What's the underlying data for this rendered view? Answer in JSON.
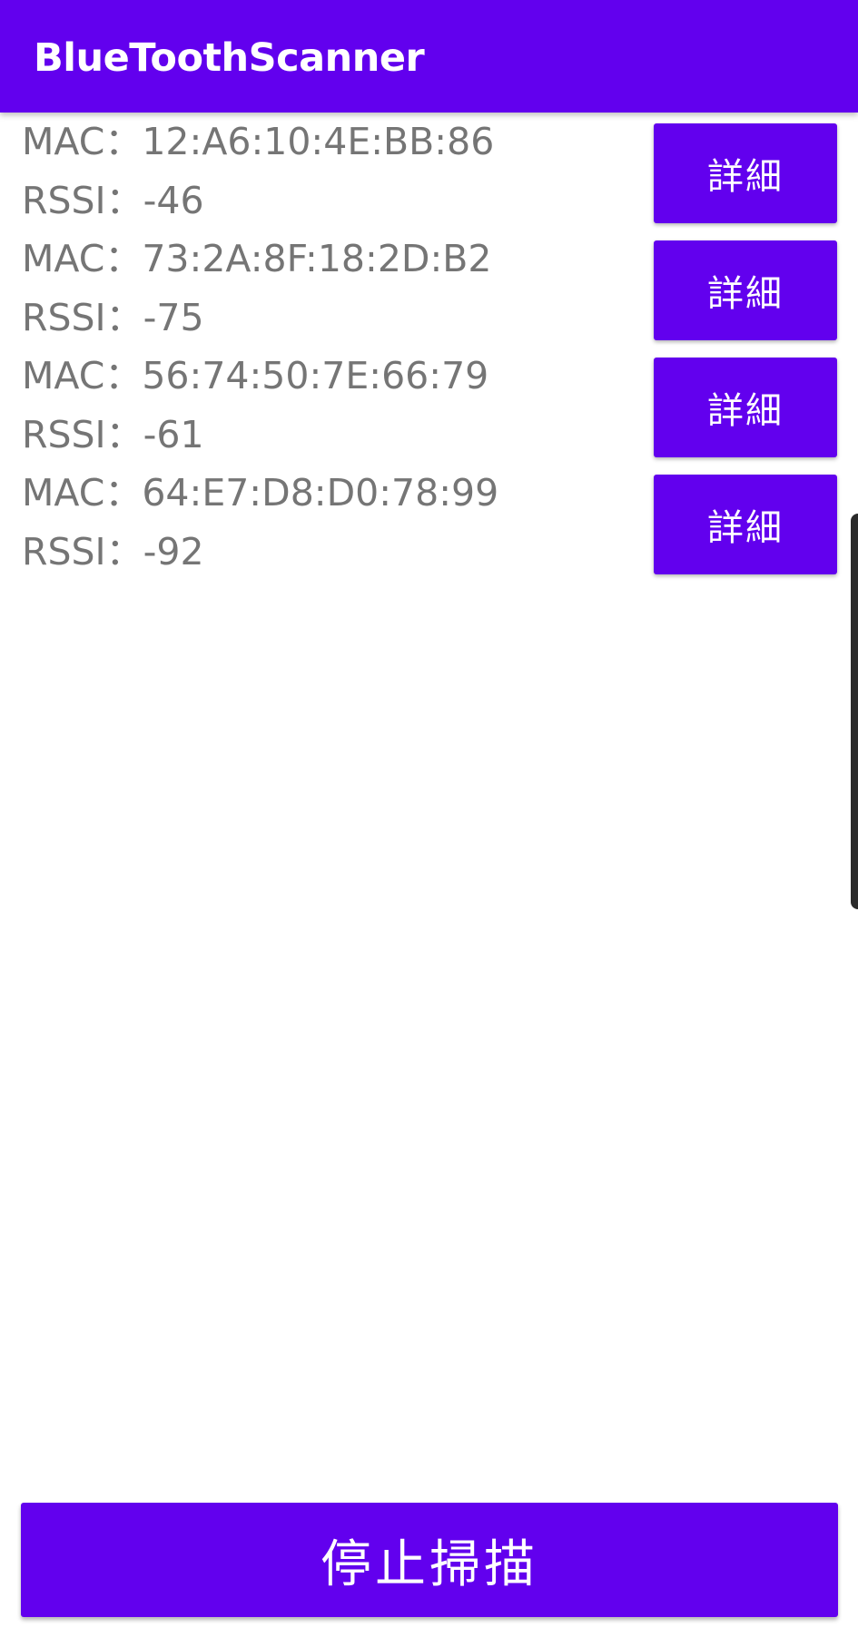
{
  "app_bar": {
    "title": "BlueToothScanner",
    "color": "#6200EE"
  },
  "devices": [
    {
      "mac_line": "MAC：12:A6:10:4E:BB:86",
      "rssi_line": "RSSI：-46",
      "button_label": "詳細"
    },
    {
      "mac_line": "MAC：73:2A:8F:18:2D:B2",
      "rssi_line": "RSSI：-75",
      "button_label": "詳細"
    },
    {
      "mac_line": "MAC：56:74:50:7E:66:79",
      "rssi_line": "RSSI：-61",
      "button_label": "詳細"
    },
    {
      "mac_line": "MAC：64:E7:D8:D0:78:99",
      "rssi_line": "RSSI：-92",
      "button_label": "詳細"
    }
  ],
  "stop_button": {
    "label": "停止掃描"
  },
  "colors": {
    "accent": "#6200EE",
    "text_secondary": "#757575",
    "background": "#FFFFFF"
  }
}
